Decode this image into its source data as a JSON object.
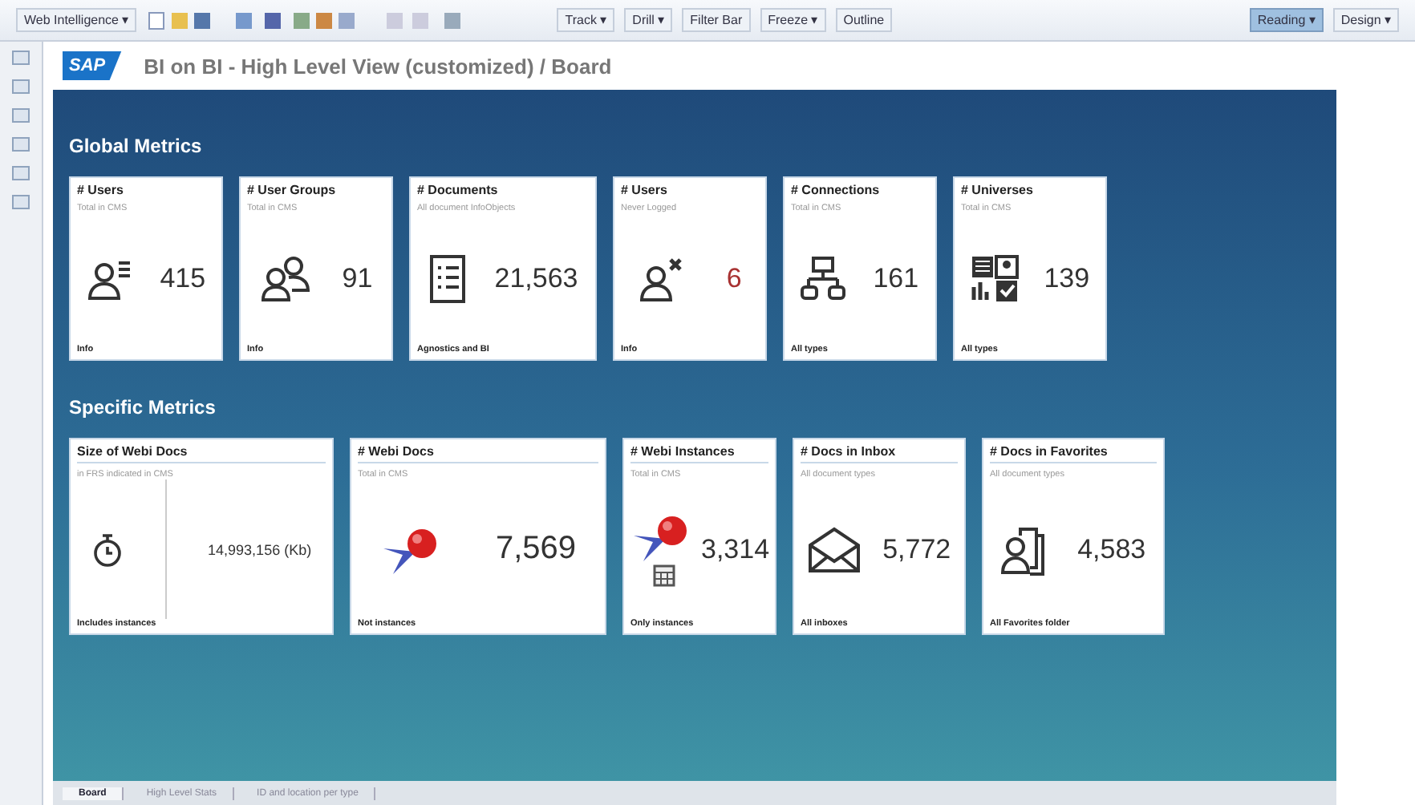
{
  "toolbar": {
    "left": [
      {
        "label": "Web Intelligence ▾"
      },
      {
        "label": "Track ▾"
      },
      {
        "label": "Drill ▾"
      },
      {
        "label": "Filter Bar"
      },
      {
        "label": "Freeze ▾"
      },
      {
        "label": "Outline"
      }
    ],
    "right": [
      {
        "label": "Reading ▾",
        "selected": true
      },
      {
        "label": "Design ▾",
        "selected": false
      }
    ]
  },
  "report": {
    "logo": "SAP",
    "title": "BI on BI - High Level View (customized) / Board"
  },
  "sections": [
    {
      "title": "Global Metrics",
      "tiles": [
        {
          "title": "# Users",
          "subtitle": "Total in CMS",
          "kind": "users",
          "value": "415",
          "color": "#333333",
          "footer": "Info"
        },
        {
          "title": "# User Groups",
          "subtitle": "Total in CMS",
          "kind": "groups",
          "value": "91",
          "color": "#333333",
          "footer": "Info"
        },
        {
          "title": "# Documents",
          "subtitle": "All document InfoObjects",
          "kind": "documents",
          "value": "21,563",
          "color": "#333333",
          "footer": "Agnostics and BI"
        },
        {
          "title": "# Users",
          "subtitle": "Never Logged",
          "kind": "inactive",
          "value": "6",
          "color": "#a83232",
          "footer": "Info"
        },
        {
          "title": "# Connections",
          "subtitle": "Total in CMS",
          "kind": "connections",
          "value": "161",
          "color": "#333333",
          "footer": "All types"
        },
        {
          "title": "# Universes",
          "subtitle": "Total in CMS",
          "kind": "universes",
          "value": "139",
          "color": "#333333",
          "footer": "All types"
        }
      ]
    },
    {
      "title": "Specific Metrics",
      "tiles": [
        {
          "title": "Size of Webi Docs",
          "subtitle": "in FRS indicated in CMS",
          "kind": "size",
          "value": "14,993,156 (Kb)",
          "color": "#333333",
          "footer": "Includes instances"
        },
        {
          "title": "# Webi Docs",
          "subtitle": "Total in CMS",
          "kind": "webi",
          "value": "7,569",
          "color": "#333333",
          "footer": "Not instances"
        },
        {
          "title": "# Webi Instances",
          "subtitle": "Total in CMS",
          "kind": "instances",
          "value": "3,314",
          "color": "#333333",
          "footer": "Only instances"
        },
        {
          "title": "# Docs in Inbox",
          "subtitle": "All document types",
          "kind": "inbox",
          "value": "5,772",
          "color": "#333333",
          "footer": "All inboxes"
        },
        {
          "title": "# Docs in Favorites",
          "subtitle": "All document types",
          "kind": "favorites",
          "value": "4,583",
          "color": "#333333",
          "footer": "All Favorites folder"
        }
      ]
    }
  ],
  "tabs": [
    {
      "label": "Board",
      "selected": true
    },
    {
      "label": "High Level Stats",
      "selected": false
    },
    {
      "label": "ID and location per type",
      "selected": false
    }
  ]
}
